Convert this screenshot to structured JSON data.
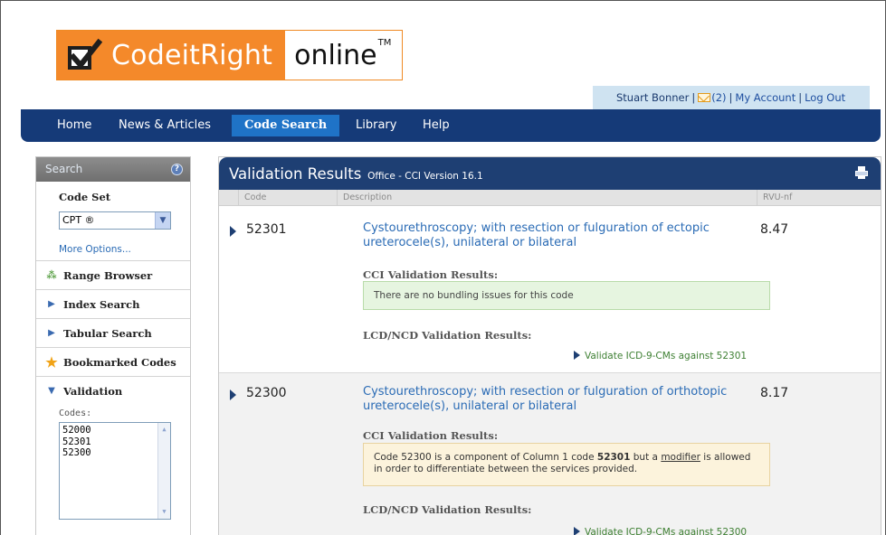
{
  "brand": {
    "name": "CodeitRight",
    "suffix": "online",
    "tm": "TM"
  },
  "user": {
    "name": "Stuart Bonner",
    "sep": "|",
    "messages": "(2)",
    "account": "My Account",
    "logout": "Log Out"
  },
  "nav": [
    "Home",
    "News & Articles",
    "Code Search",
    "Library",
    "Help"
  ],
  "sidebar": {
    "header": "Search",
    "help": "?",
    "code_set_label": "Code Set",
    "code_set_value": "CPT ®",
    "more_options": "More Options...",
    "items": [
      "Range Browser",
      "Index Search",
      "Tabular Search",
      "Bookmarked Codes",
      "Validation"
    ],
    "codes_label": "Codes:",
    "codes": [
      "52000",
      "52301",
      "52300"
    ]
  },
  "main": {
    "title": "Validation Results",
    "subtitle": "Office - CCI Version 16.1",
    "columns": [
      "Code",
      "Description",
      "RVU-nf"
    ],
    "results": [
      {
        "code": "52301",
        "description": "Cystourethroscopy; with resection or fulguration of ectopic ureterocele(s), unilateral or bilateral",
        "rvu": "8.47",
        "cci_label": "CCI Validation Results:",
        "cci_message": "There are no bundling issues for this code",
        "lcd_label": "LCD/NCD Validation Results:",
        "validate_link": "Validate ICD-9-CMs against 52301"
      },
      {
        "code": "52300",
        "description": "Cystourethroscopy; with resection or fulguration of orthotopic ureterocele(s), unilateral or bilateral",
        "rvu": "8.17",
        "cci_label": "CCI Validation Results:",
        "cci_message_pre": "Code 52300 is a component of Column 1 code ",
        "cci_message_code": "52301",
        "cci_message_mid": " but a ",
        "cci_message_link": "modifier",
        "cci_message_post": " is allowed in order to differentiate between the services provided.",
        "lcd_label": "LCD/NCD Validation Results:",
        "validate_link": "Validate ICD-9-CMs against 52300"
      }
    ]
  },
  "colors": {
    "nav": "#153a78",
    "nav_active": "#1f73c7",
    "brand_orange": "#f4892a",
    "link": "#2a6bb5",
    "ok_bg": "#e6f5e0",
    "warn_bg": "#fcf3dc"
  }
}
